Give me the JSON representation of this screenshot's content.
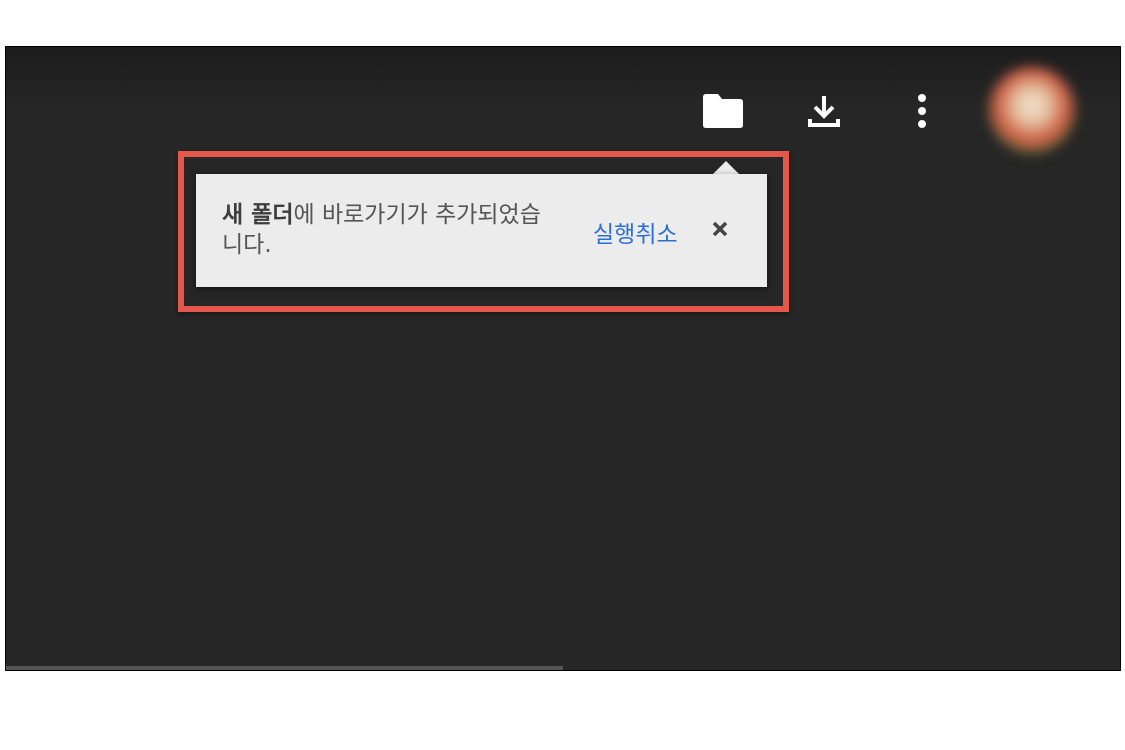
{
  "toolbar": {
    "folder_icon": "folder-icon",
    "download_icon": "download-icon",
    "more_icon": "more-vertical-icon",
    "avatar": "user-avatar"
  },
  "toast": {
    "folder_name": "새 폴더",
    "message_rest": "에 바로가기가 추가되었습니다.",
    "undo_label": "실행취소",
    "close_icon": "close-icon"
  },
  "colors": {
    "background": "#262626",
    "toast_bg": "#ececec",
    "link": "#2a6fd6",
    "highlight": "#e4584b"
  },
  "progress": {
    "fraction": 0.5
  }
}
